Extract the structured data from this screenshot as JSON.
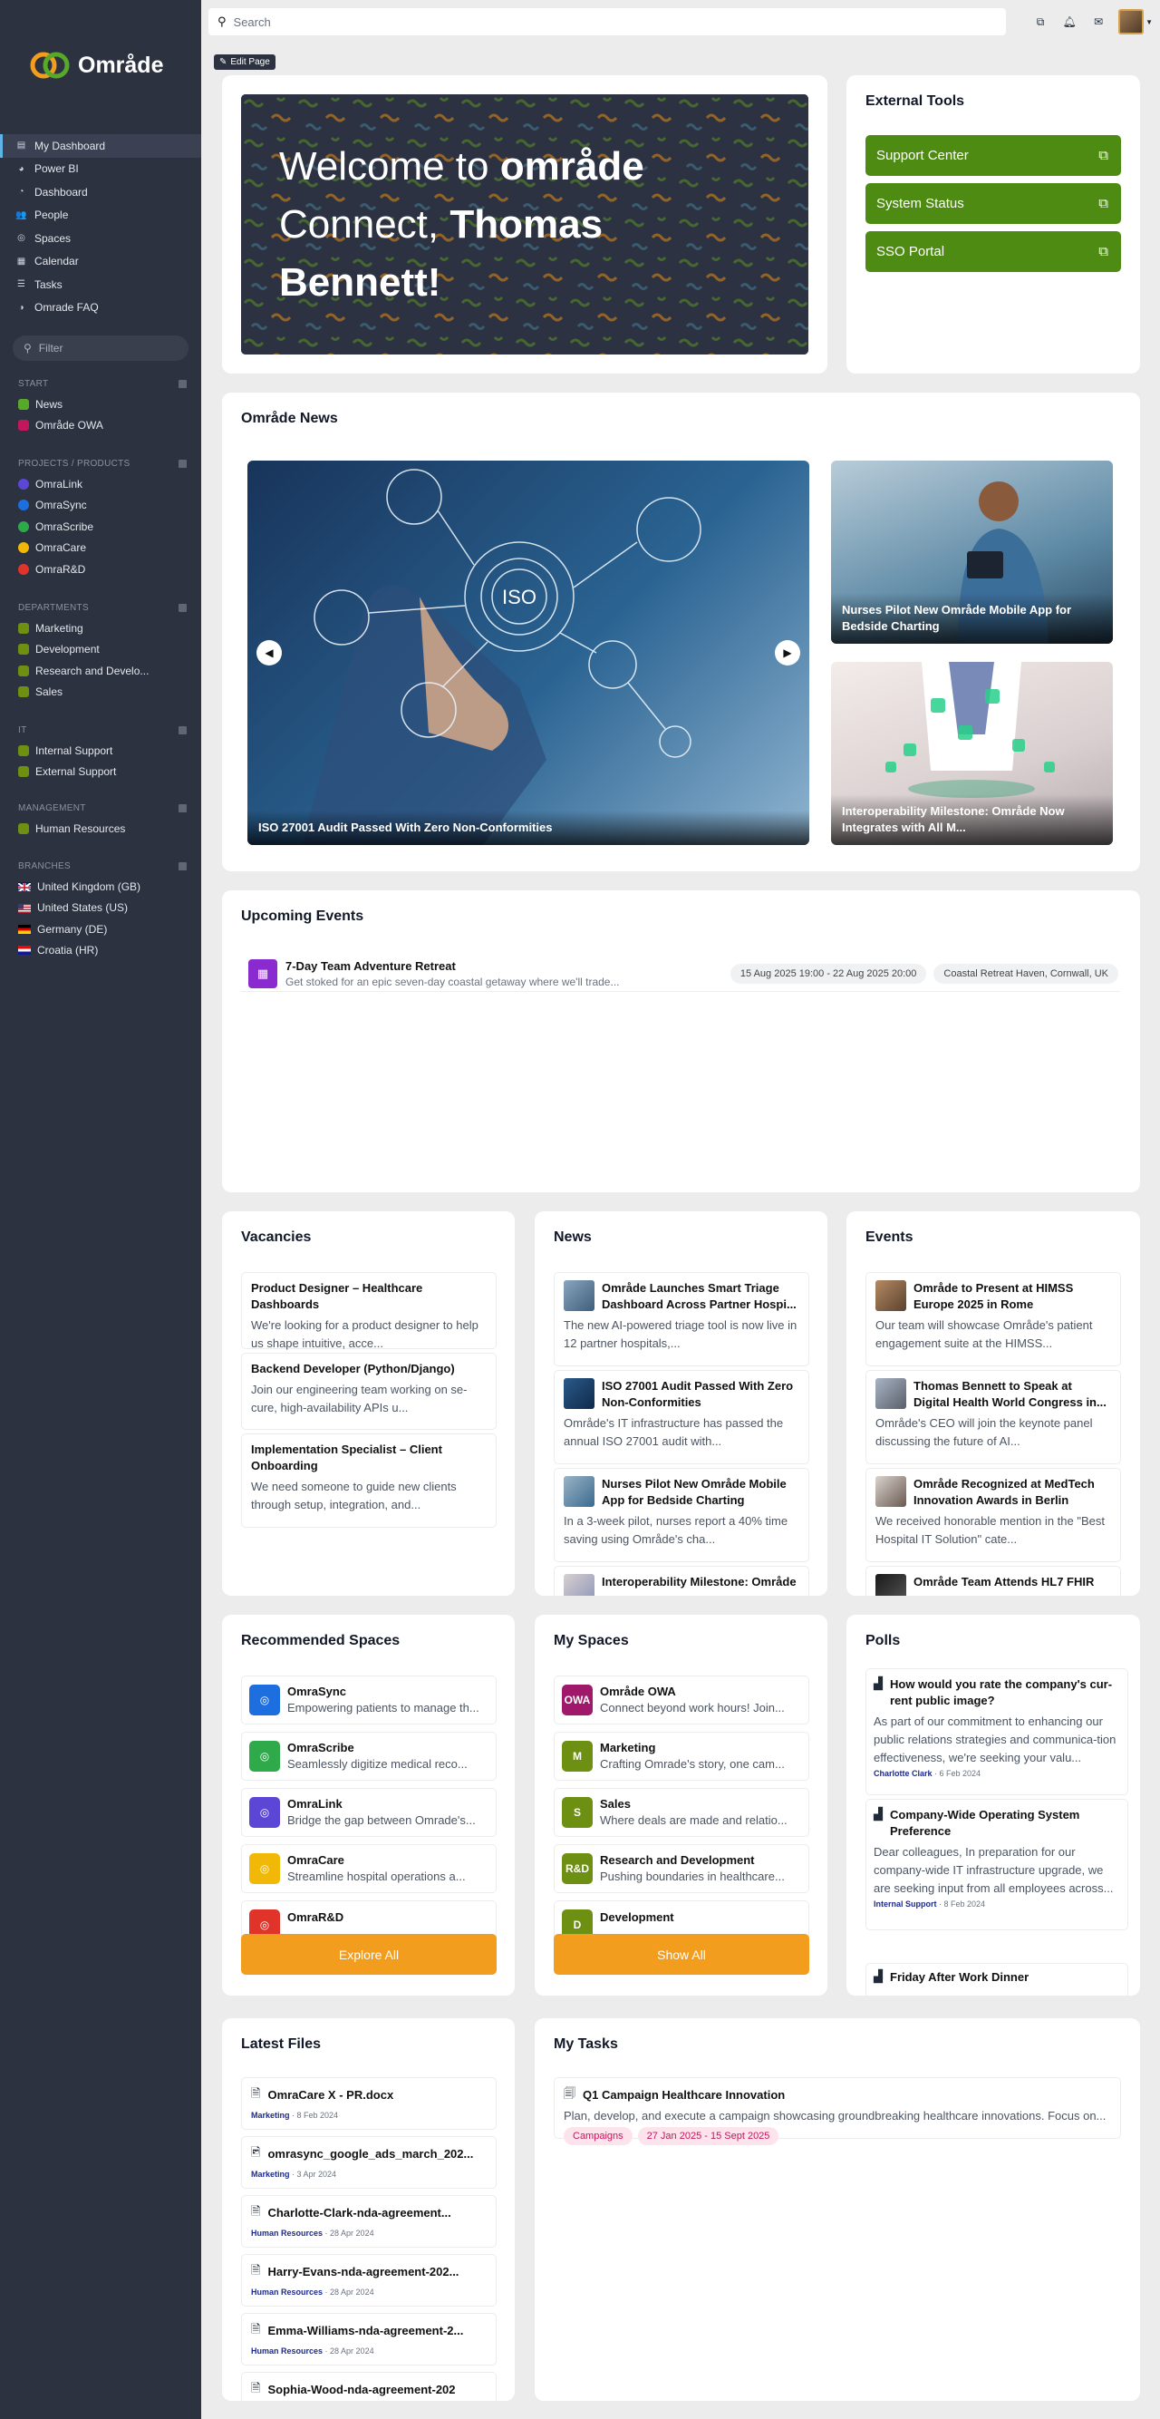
{
  "app": {
    "brand": "Område",
    "edit_page": "Edit Page"
  },
  "search": {
    "placeholder": "Search"
  },
  "sidebar": {
    "nav": [
      {
        "label": "My Dashboard",
        "icon": "dashboard-icon"
      },
      {
        "label": "Power BI",
        "icon": "chart-pie-icon"
      },
      {
        "label": "Dashboard",
        "icon": "dashboard-grid-icon"
      },
      {
        "label": "People",
        "icon": "people-icon"
      },
      {
        "label": "Spaces",
        "icon": "spaces-icon"
      },
      {
        "label": "Calendar",
        "icon": "calendar-icon"
      },
      {
        "label": "Tasks",
        "icon": "tasks-icon"
      },
      {
        "label": "Omrade FAQ",
        "icon": "faq-icon"
      }
    ],
    "filter_placeholder": "Filter",
    "sections": [
      {
        "title": "START",
        "items": [
          {
            "label": "News",
            "color": "#58a829"
          },
          {
            "label": "Område OWA",
            "color": "#c2185b"
          }
        ]
      },
      {
        "title": "PROJECTS / PRODUCTS",
        "items": [
          {
            "label": "OmraLink",
            "color": "#5b46d6"
          },
          {
            "label": "OmraSync",
            "color": "#1d6fe0"
          },
          {
            "label": "OmraScribe",
            "color": "#2eaa4a"
          },
          {
            "label": "OmraCare",
            "color": "#f2b807"
          },
          {
            "label": "OmraR&D",
            "color": "#e0342b"
          }
        ]
      },
      {
        "title": "DEPARTMENTS",
        "items": [
          {
            "label": "Marketing",
            "color": "#58a829"
          },
          {
            "label": "Development",
            "color": "#58a829"
          },
          {
            "label": "Research and Develo...",
            "color": "#58a829"
          },
          {
            "label": "Sales",
            "color": "#58a829"
          }
        ]
      },
      {
        "title": "IT",
        "items": [
          {
            "label": "Internal Support",
            "color": "#58a829"
          },
          {
            "label": "External Support",
            "color": "#58a829"
          }
        ]
      },
      {
        "title": "MANAGEMENT",
        "items": [
          {
            "label": "Human Resources",
            "color": "#58a829"
          }
        ]
      },
      {
        "title": "BRANCHES",
        "items": [
          {
            "label": "United Kingdom (GB)",
            "flag": "gb"
          },
          {
            "label": "United States (US)",
            "flag": "us"
          },
          {
            "label": "Germany (DE)",
            "flag": "de"
          },
          {
            "label": "Croatia (HR)",
            "flag": "hr"
          }
        ]
      }
    ]
  },
  "welcome": {
    "line1a": "Welcome to ",
    "line1b": "område",
    "line2a": "Connect, ",
    "line2b": "Thomas",
    "line3": "Bennett!"
  },
  "external_tools": {
    "title": "External Tools",
    "items": [
      "Support Center",
      "System Status",
      "SSO Portal"
    ]
  },
  "news_carousel": {
    "title": "Område News",
    "main": "ISO 27001 Audit Passed With Zero Non-Conformities",
    "side1": "Nurses Pilot New Område Mobile App for Bedside Charting",
    "side2": "Interoperability Milestone: Område Now Integrates with All M..."
  },
  "upcoming": {
    "title": "Upcoming Events",
    "event": {
      "title": "7-Day Team Adventure Retreat",
      "desc": "Get stoked for an epic seven-day coastal getaway where we'll trade...",
      "dates": "15 Aug 2025 19:00 - 22 Aug 2025 20:00",
      "location": "Coastal Retreat Haven, Cornwall, UK"
    }
  },
  "vacancies": {
    "title": "Vacancies",
    "items": [
      {
        "title": "Product Designer – Healthcare Dashboards",
        "desc": "We're looking for a product designer to help us shape intuitive, acce..."
      },
      {
        "title": "Backend Developer (Python/Django)",
        "desc": "Join our engineering team working on se-cure, high-availability APIs u..."
      },
      {
        "title": "Implementation Specialist – Client Onboarding",
        "desc": "We need someone to guide new clients through setup, integration, and..."
      }
    ]
  },
  "news": {
    "title": "News",
    "items": [
      {
        "title": "Område Launches Smart Triage Dashboard Across Partner Hospi...",
        "desc": "The new AI-powered triage tool is now live in 12 partner hospitals,..."
      },
      {
        "title": "ISO 27001 Audit Passed With Zero Non-Conformities",
        "desc": "Område's IT infrastructure has passed the annual ISO 27001 audit with..."
      },
      {
        "title": "Nurses Pilot New Område Mobile App for Bedside Charting",
        "desc": "In a 3-week pilot, nurses report a 40% time saving using Område's cha..."
      },
      {
        "title": "Interoperability Milestone: Område",
        "desc": ""
      }
    ]
  },
  "events": {
    "title": "Events",
    "items": [
      {
        "title": "Område to Present at HIMSS Europe 2025 in Rome",
        "desc": "Our team will showcase Område's patient engagement suite at the HIMSS..."
      },
      {
        "title": "Thomas Bennett to Speak at Digital Health World Congress in...",
        "desc": "Område's CEO will join the keynote panel discussing the future of AI..."
      },
      {
        "title": "Område Recognized at MedTech Innovation Awards in Berlin",
        "desc": "We received honorable mention in the \"Best Hospital IT Solution\" cate..."
      },
      {
        "title": "Område Team Attends HL7 FHIR",
        "desc": ""
      }
    ]
  },
  "recommended_spaces": {
    "title": "Recommended Spaces",
    "items": [
      {
        "title": "OmraSync",
        "desc": "Empowering patients to manage th...",
        "color": "#1d6fe0"
      },
      {
        "title": "OmraScribe",
        "desc": "Seamlessly digitize medical reco...",
        "color": "#2eaa4a"
      },
      {
        "title": "OmraLink",
        "desc": "Bridge the gap between Omrade's...",
        "color": "#5b46d6"
      },
      {
        "title": "OmraCare",
        "desc": "Streamline hospital operations a...",
        "color": "#f2b807"
      },
      {
        "title": "OmraR&D",
        "desc": "",
        "color": "#e0342b"
      }
    ],
    "button": "Explore All"
  },
  "my_spaces": {
    "title": "My Spaces",
    "items": [
      {
        "title": "Område OWA",
        "desc": "Connect beyond work hours! Join...",
        "abbr": "OWA",
        "color": "#a0186a"
      },
      {
        "title": "Marketing",
        "desc": "Crafting Omrade's story, one cam...",
        "abbr": "M",
        "color": "#6d8f12"
      },
      {
        "title": "Sales",
        "desc": "Where deals are made and relatio...",
        "abbr": "S",
        "color": "#6d8f12"
      },
      {
        "title": "Research and Development",
        "desc": "Pushing boundaries in healthcare...",
        "abbr": "R&D",
        "color": "#6d8f12"
      },
      {
        "title": "Development",
        "desc": "",
        "abbr": "D",
        "color": "#6d8f12"
      }
    ],
    "button": "Show All"
  },
  "polls": {
    "title": "Polls",
    "items": [
      {
        "title": "How would you rate the company's cur-rent public image?",
        "desc": "As part of our commitment to enhancing our public relations strategies and communica-tion effectiveness, we're seeking your valu...",
        "author": "Charlotte Clark",
        "date": "6 Feb 2024"
      },
      {
        "title": "Company-Wide Operating System Preference",
        "desc": "Dear colleagues, In preparation for our company-wide IT infrastructure upgrade, we are seeking input from all employees across...",
        "author": "Internal Support",
        "date": "8 Feb 2024"
      },
      {
        "title": "Friday After Work Dinner",
        "desc": "",
        "author": "",
        "date": ""
      }
    ]
  },
  "latest_files": {
    "title": "Latest Files",
    "items": [
      {
        "name": "OmraCare X - PR.docx",
        "space": "Marketing",
        "date": "8 Feb 2024"
      },
      {
        "name": "omrasync_google_ads_march_202...",
        "space": "Marketing",
        "date": "3 Apr 2024"
      },
      {
        "name": "Charlotte-Clark-nda-agreement...",
        "space": "Human Resources",
        "date": "28 Apr 2024"
      },
      {
        "name": "Harry-Evans-nda-agreement-202...",
        "space": "Human Resources",
        "date": "28 Apr 2024"
      },
      {
        "name": "Emma-Williams-nda-agreement-2...",
        "space": "Human Resources",
        "date": "28 Apr 2024"
      },
      {
        "name": "Sophia-Wood-nda-agreement-202",
        "space": "",
        "date": ""
      }
    ]
  },
  "my_tasks": {
    "title": "My Tasks",
    "task": {
      "title": "Q1 Campaign Healthcare Innovation",
      "desc": "Plan, develop, and execute a campaign showcasing groundbreaking healthcare innovations. Focus on...",
      "tag": "Campaigns",
      "dates": "27 Jan 2025 - 15 Sept 2025"
    }
  }
}
